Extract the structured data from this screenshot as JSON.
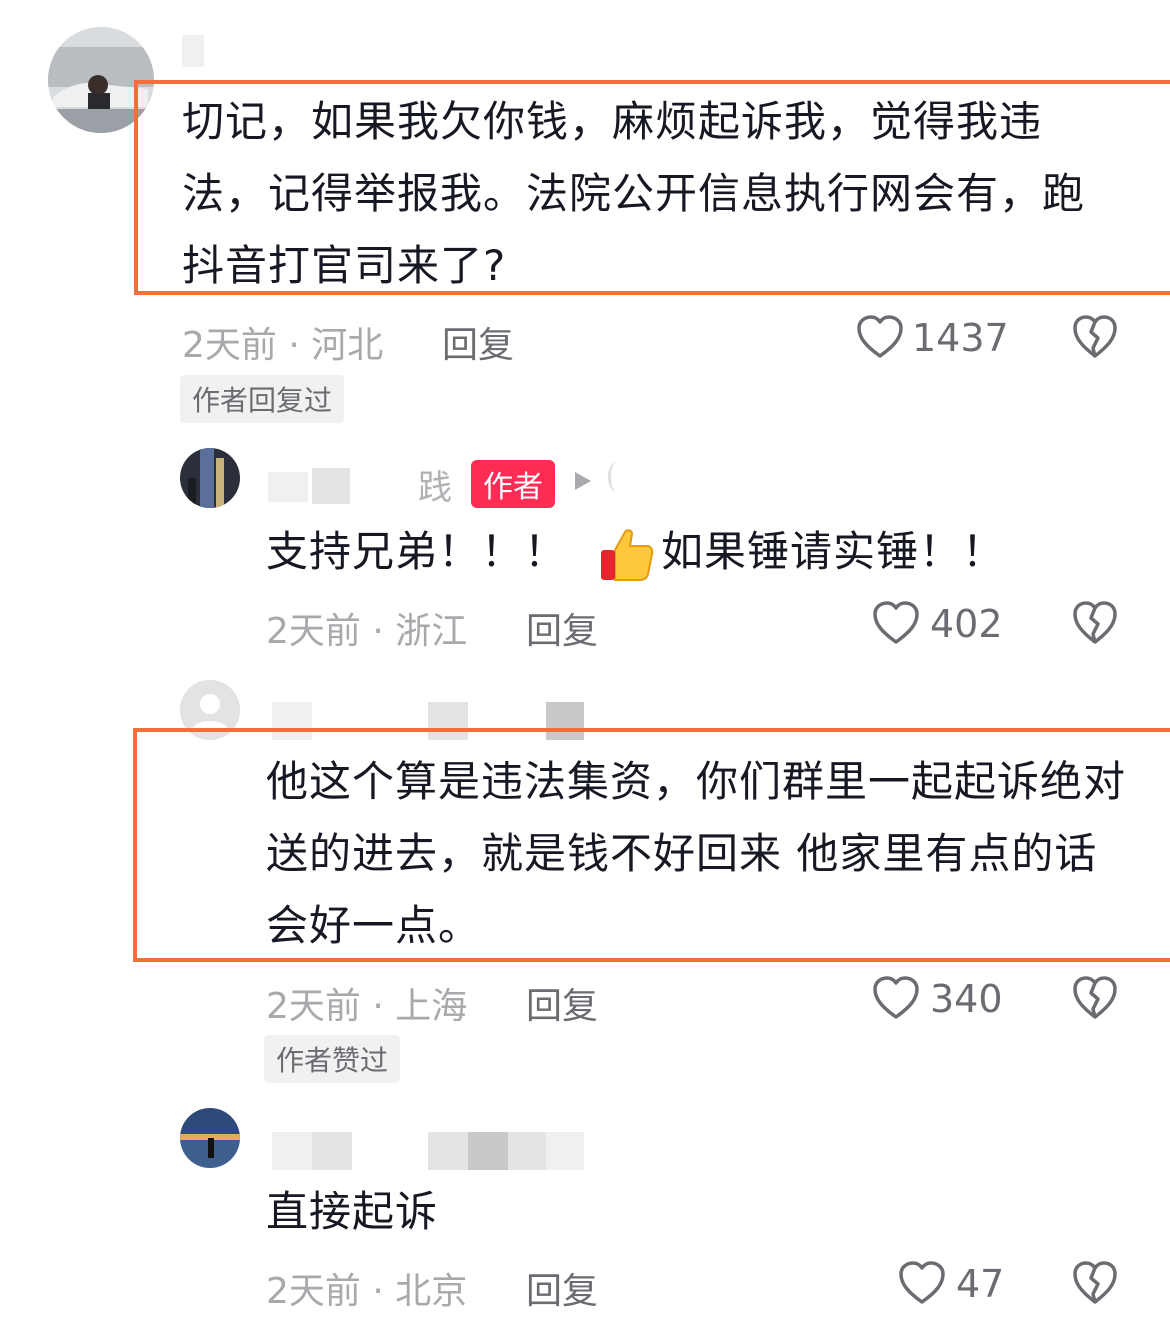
{
  "colors": {
    "highlight": "#f0703a",
    "author_badge": "#fe2c55",
    "meta_text": "#a8a9ad",
    "body_text": "#161823"
  },
  "comments": [
    {
      "text": "切记，如果我欠你钱，麻烦起诉我，觉得我违法，记得举报我。法院公开信息执行网会有，跑抖音打官司来了?",
      "meta": "2天前 · 河北",
      "reply_label": "回复",
      "likes": "1437",
      "tag": "作者回复过",
      "highlighted": true
    },
    {
      "username_visible": "践",
      "author_badge": "作者",
      "text_before_emoji": "支持兄弟！！！",
      "emoji": "thumbs-up-emoji",
      "text_after_emoji": "如果锤请实锤！！",
      "meta": "2天前 · 浙江",
      "reply_label": "回复",
      "likes": "402"
    },
    {
      "text": "他这个算是违法集资，你们群里一起起诉绝对送的进去，就是钱不好回来 他家里有点的话会好一点。",
      "meta": "2天前 · 上海",
      "reply_label": "回复",
      "likes": "340",
      "tag": "作者赞过",
      "highlighted": true
    },
    {
      "text": "直接起诉",
      "meta": "2天前 · 北京",
      "reply_label": "回复",
      "likes": "47"
    }
  ],
  "icons": {
    "like": "heart-outline-icon",
    "dislike": "broken-heart-icon",
    "play": "play-triangle-icon"
  }
}
